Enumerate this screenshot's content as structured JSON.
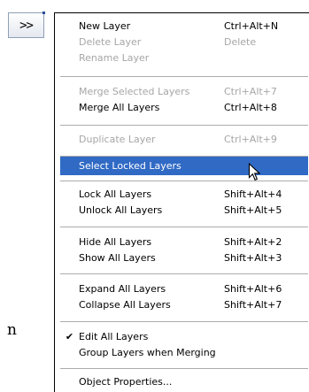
{
  "expand_button": {
    "label": ">>"
  },
  "background_text": "n",
  "menu": {
    "items": [
      {
        "label": "New Layer",
        "shortcut": "Ctrl+Alt+N",
        "enabled": true
      },
      {
        "label": "Delete Layer",
        "shortcut": "Delete",
        "enabled": false
      },
      {
        "label": "Rename Layer",
        "shortcut": "",
        "enabled": false
      },
      {
        "label": "Merge Selected Layers",
        "shortcut": "Ctrl+Alt+7",
        "enabled": false
      },
      {
        "label": "Merge All Layers",
        "shortcut": "Ctrl+Alt+8",
        "enabled": true
      },
      {
        "label": "Duplicate Layer",
        "shortcut": "Ctrl+Alt+9",
        "enabled": false
      },
      {
        "label": "Select Locked Layers",
        "shortcut": "",
        "enabled": true,
        "highlighted": true
      },
      {
        "label": "Lock All Layers",
        "shortcut": "Shift+Alt+4",
        "enabled": true
      },
      {
        "label": "Unlock All Layers",
        "shortcut": "Shift+Alt+5",
        "enabled": true
      },
      {
        "label": "Hide All Layers",
        "shortcut": "Shift+Alt+2",
        "enabled": true
      },
      {
        "label": "Show All Layers",
        "shortcut": "Shift+Alt+3",
        "enabled": true
      },
      {
        "label": "Expand All Layers",
        "shortcut": "Shift+Alt+6",
        "enabled": true
      },
      {
        "label": "Collapse All Layers",
        "shortcut": "Shift+Alt+7",
        "enabled": true
      },
      {
        "label": "Edit All Layers",
        "shortcut": "",
        "enabled": true,
        "checked": true
      },
      {
        "label": "Group Layers when Merging",
        "shortcut": "",
        "enabled": true
      },
      {
        "label": "Object Properties...",
        "shortcut": "",
        "enabled": true
      }
    ],
    "check_glyph": "✔",
    "highlight_color": "#316ac5"
  }
}
